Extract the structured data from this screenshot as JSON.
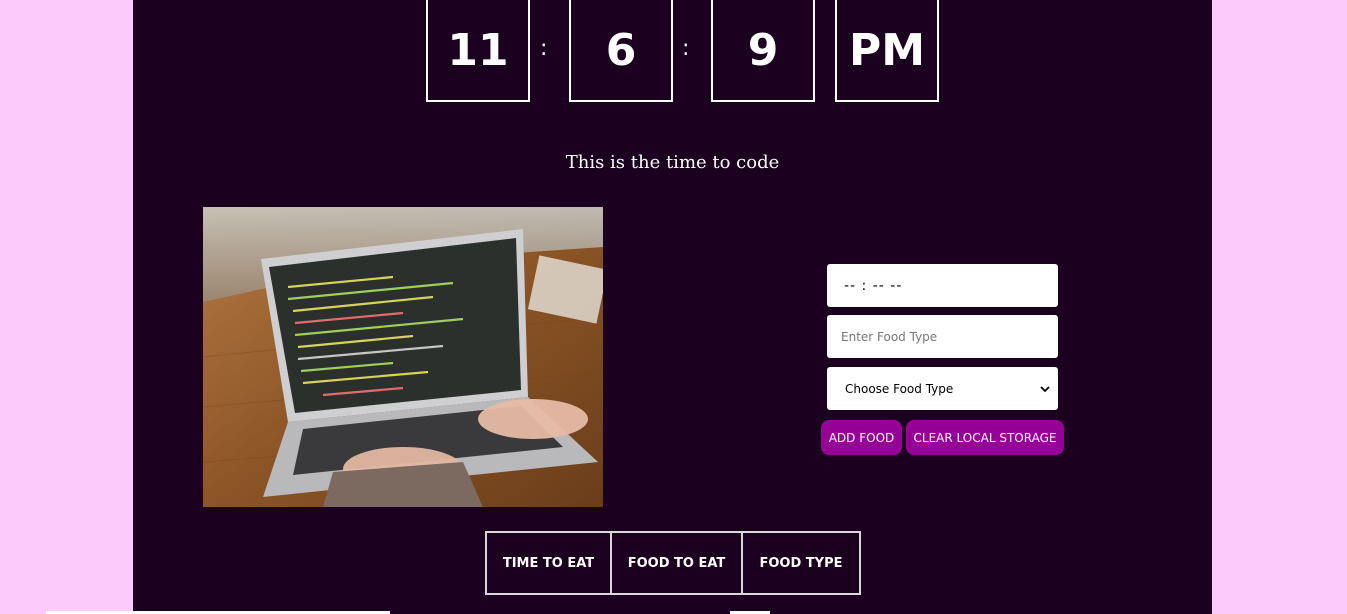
{
  "clock": {
    "hours": "11",
    "minutes": "6",
    "seconds": "9",
    "period": "PM",
    "separator": ":"
  },
  "message": "This is the time to code",
  "image": {
    "icon": "laptop-coding-photo"
  },
  "form": {
    "time_value": "-- : --   --",
    "food_placeholder": "Enter Food Type",
    "select_value": "Choose Food Type",
    "add_button": "ADD FOOD",
    "clear_button": "CLEAR LOCAL STORAGE"
  },
  "table": {
    "headers": [
      "TIME TO EAT",
      "FOOD TO EAT",
      "FOOD TYPE"
    ]
  },
  "colors": {
    "page_bg": "#fccbfb",
    "panel_bg": "#1b0020",
    "button_bg": "#970097"
  }
}
